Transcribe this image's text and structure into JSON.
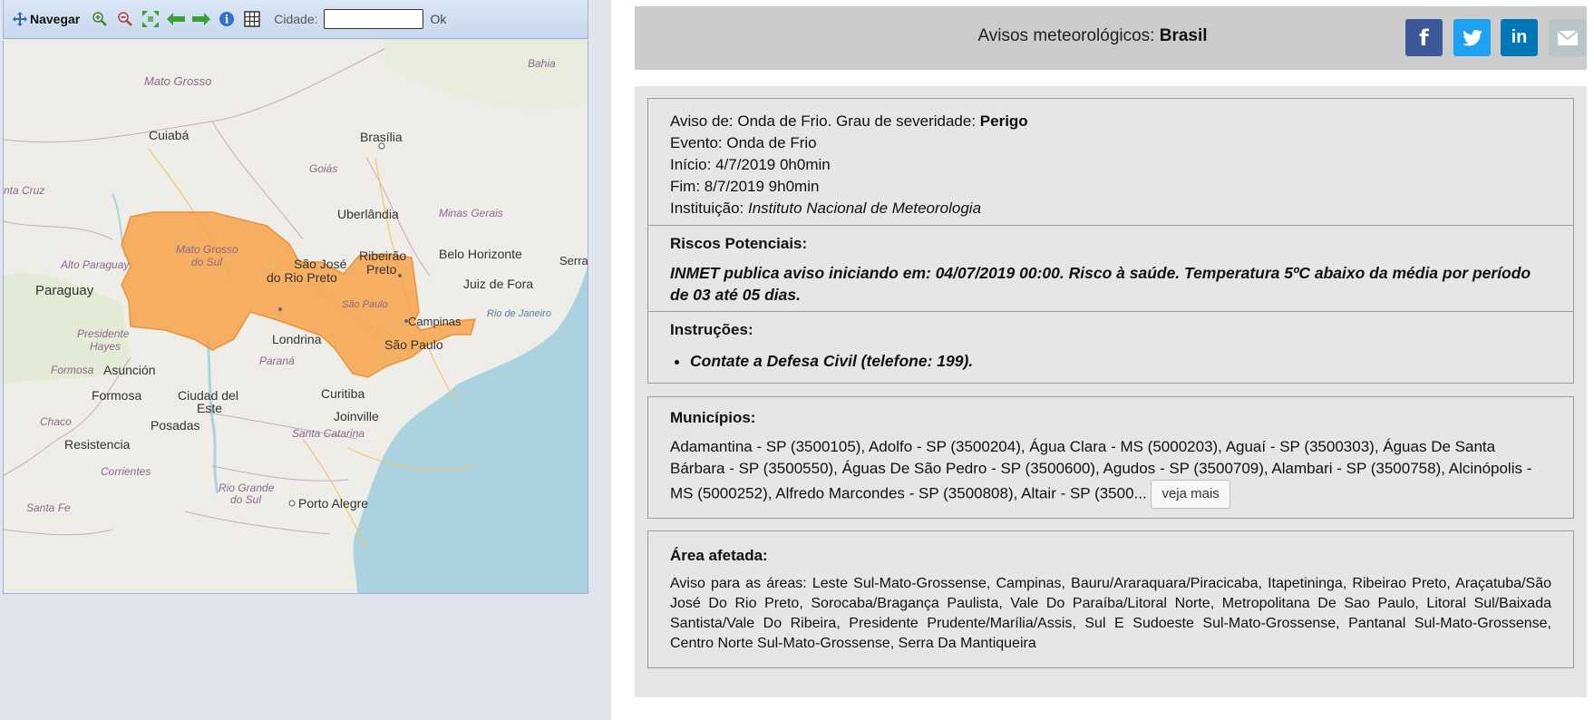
{
  "toolbar": {
    "nav_label": "Navegar",
    "city_label": "Cidade:",
    "city_value": "",
    "ok_label": "Ok",
    "icons": [
      "move-icon",
      "zoom-in-icon",
      "zoom-out-icon",
      "zoom-extent-icon",
      "back-arrow-icon",
      "forward-arrow-icon",
      "info-icon",
      "grid-icon"
    ]
  },
  "map": {
    "labels": {
      "bahia": "Bahia",
      "mato_grosso": "Mato Grosso",
      "cuiaba": "Cuiabá",
      "brasilia": "Brasília",
      "goias": "Goiás",
      "santa_cruz": "nta Cruz",
      "uberlandia": "Uberlândia",
      "minas_gerais": "Minas Gerais",
      "ribeirao": "Ribeirão",
      "preto": "Preto",
      "belo_horizonte": "Belo Horizonte",
      "alto_paraguay": "Alto Paraguay",
      "mato_grosso_do_sul_1": "Mato Grosso",
      "mato_grosso_do_sul_2": "do Sul",
      "sao_jose": "São José",
      "do_rio_preto": "do Rio Preto",
      "serra": "Serra",
      "paraguay": "Paraguay",
      "juiz_de_fora": "Juiz de Fora",
      "sao_paulo_state": "São Paulo",
      "rio_de_janeiro": "Rio de Janeiro",
      "campinas": "Campinas",
      "presidente": "Presidente",
      "hayes": "Hayes",
      "londrina": "Londrina",
      "sao_paulo": "São Paulo",
      "formosa_state": "Formosa",
      "asuncion": "Asunción",
      "parana": "Paraná",
      "formosa": "Formosa",
      "ciudad_del": "Ciudad del",
      "este": "Este",
      "curitiba": "Curitiba",
      "chaco": "Chaco",
      "posadas": "Posadas",
      "joinville": "Joinville",
      "resistencia": "Resistencia",
      "santa_catarina": "Santa Catarina",
      "corrientes": "Corrientes",
      "rio_grande": "Rio Grande",
      "do_sul": "do Sul",
      "santa_fe": "Santa Fe",
      "porto_alegre": "Porto Alegre"
    },
    "alert_color": "#f7a24a",
    "sea_color": "#aad3df",
    "land_color": "#efede7"
  },
  "header": {
    "title_prefix": "Avisos meteorológicos:",
    "title_bold": "Brasil",
    "social": [
      {
        "icon": "facebook-icon",
        "label": "f",
        "color": "#3b5998"
      },
      {
        "icon": "twitter-icon",
        "label": "t",
        "color": "#1da1f2"
      },
      {
        "icon": "linkedin-icon",
        "label": "in",
        "color": "#0077b5"
      },
      {
        "icon": "email-icon",
        "label": "",
        "color": "#b9c4c9"
      }
    ]
  },
  "warning": {
    "aviso_prefix": "Aviso de: Onda de Frio. Grau de severidade:",
    "severity": "Perigo",
    "evento": "Evento: Onda de Frio",
    "inicio": "Início: 4/7/2019 0h0min",
    "fim": "Fim: 8/7/2019 9h0min",
    "instituicao_prefix": "Instituição:",
    "instituicao": "Instituto Nacional de Meteorologia",
    "riscos_title": "Riscos Potenciais:",
    "riscos_text": "INMET publica aviso iniciando em: 04/07/2019 00:00. Risco à saúde. Temperatura 5ºC abaixo da média por período de 03 até 05 dias.",
    "instrucoes_title": "Instruções:",
    "instrucoes": [
      "Contate a Defesa Civil (telefone: 199)."
    ]
  },
  "municipios": {
    "title": "Municípios:",
    "text": "Adamantina - SP (3500105), Adolfo - SP (3500204), Água Clara - MS (5000203), Aguaí - SP (3500303), Águas De Santa Bárbara - SP (3500550), Águas De São Pedro - SP (3500600), Agudos - SP (3500709), Alambari - SP (3500758), Alcinópolis - MS (5000252), Alfredo Marcondes - SP (3500808), Altair - SP (3500...",
    "more_button": "veja mais"
  },
  "area": {
    "title": "Área afetada:",
    "text": "Aviso para as áreas: Leste Sul-Mato-Grossense, Campinas, Bauru/Araraquara/Piracicaba, Itapetininga, Ribeirao Preto, Araçatuba/São José Do Rio Preto, Sorocaba/Bragança Paulista, Vale Do Paraíba/Litoral Norte, Metropolitana De Sao Paulo, Litoral Sul/Baixada Santista/Vale Do Ribeira, Presidente Prudente/Marília/Assis, Sul E Sudoeste Sul-Mato-Grossense, Pantanal Sul-Mato-Grossense, Centro Norte Sul-Mato-Grossense, Serra Da Mantiqueira"
  }
}
